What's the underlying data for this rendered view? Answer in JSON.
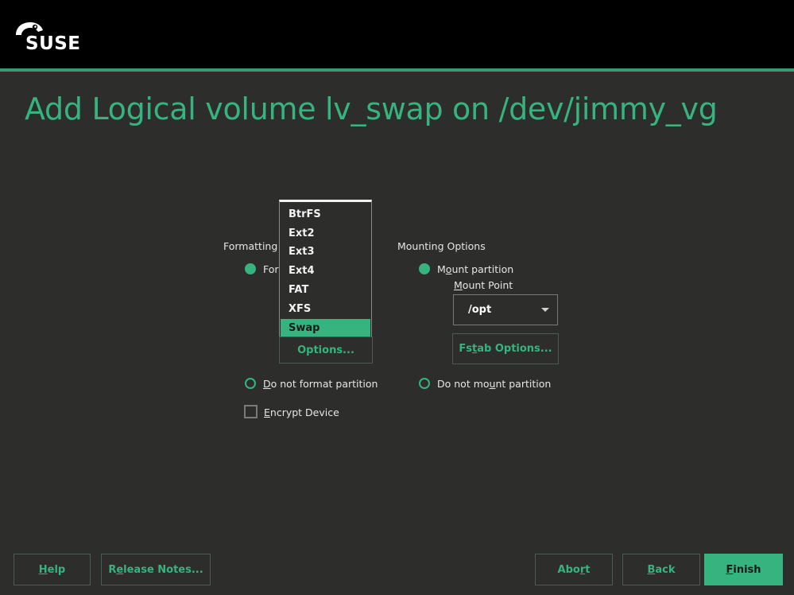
{
  "header": {
    "brand": "SUSE",
    "title": "Add Logical volume lv_swap on /dev/jimmy_vg"
  },
  "formatting": {
    "group_label": "Formatting",
    "format_radio_label": "For",
    "filesystem_options": [
      "BtrFS",
      "Ext2",
      "Ext3",
      "Ext4",
      "FAT",
      "XFS",
      "Swap"
    ],
    "selected_filesystem": "Swap",
    "options_button": "Options...",
    "no_format_label_prefix": "D",
    "no_format_label_rest": "o not format partition",
    "encrypt_label_prefix": "E",
    "encrypt_label_rest": "ncrypt Device"
  },
  "mounting": {
    "group_label": "Mounting Options",
    "mount_label_a": "M",
    "mount_label_u": "o",
    "mount_label_b": "unt partition",
    "mount_point_label_u": "M",
    "mount_point_label_rest": "ount Point",
    "mount_point_value": "/opt",
    "fstab_button_a": "Fs",
    "fstab_button_u": "t",
    "fstab_button_b": "ab Options...",
    "no_mount_label_a": "Do not mo",
    "no_mount_label_u": "u",
    "no_mount_label_b": "nt partition"
  },
  "footer": {
    "help_u": "H",
    "help_rest": "elp",
    "release_notes_a": "R",
    "release_notes_u": "e",
    "release_notes_b": "lease Notes...",
    "abort_a": "Abo",
    "abort_u": "r",
    "abort_b": "t",
    "back_u": "B",
    "back_rest": "ack",
    "finish_u": "F",
    "finish_rest": "inish"
  },
  "colors": {
    "accent": "#36b37e",
    "background": "#2d2e2c",
    "header": "#000000"
  }
}
